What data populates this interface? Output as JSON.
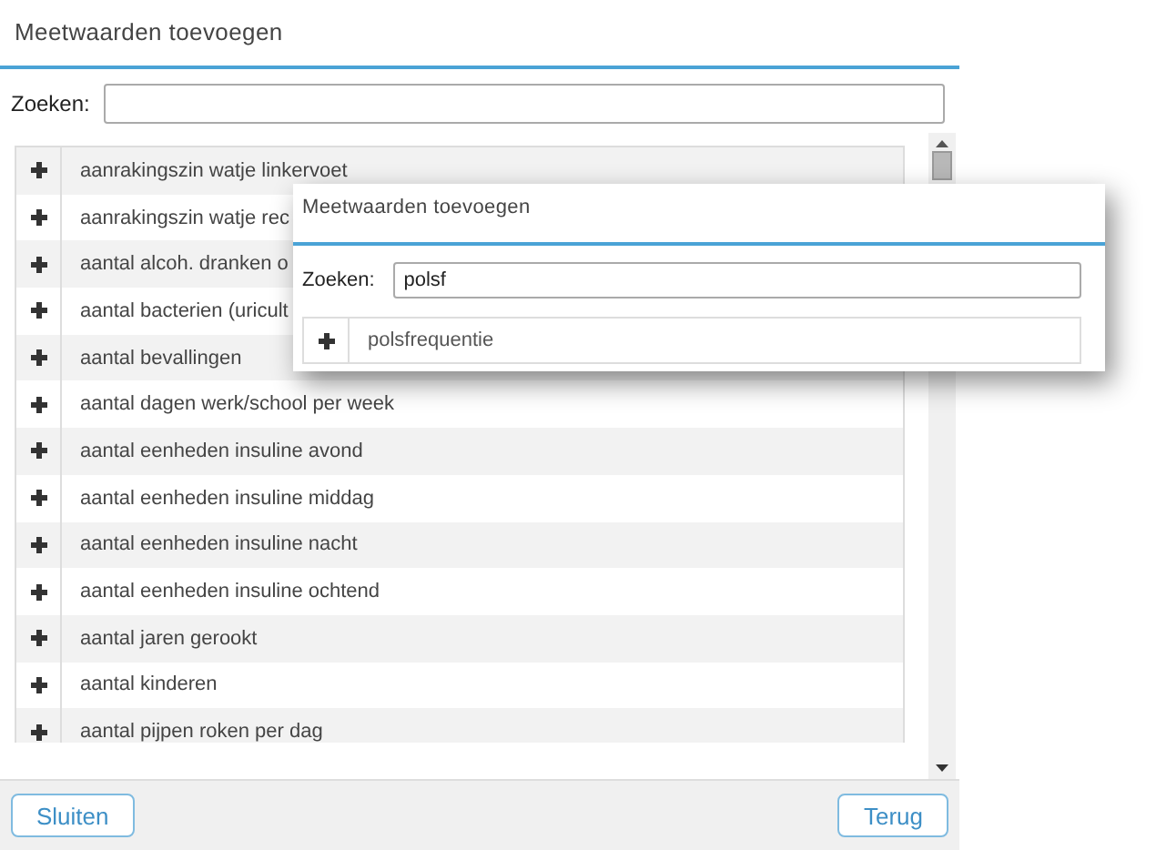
{
  "dialog": {
    "title": "Meetwaarden toevoegen",
    "search": {
      "label": "Zoeken:"
    },
    "items": [
      {
        "label": "aanrakingszin watje linkervoet"
      },
      {
        "label": "aanrakingszin watje rec"
      },
      {
        "label": "aantal alcoh. dranken o"
      },
      {
        "label": "aantal bacterien (uricult"
      },
      {
        "label": "aantal bevallingen"
      },
      {
        "label": "aantal dagen werk/school per week"
      },
      {
        "label": "aantal eenheden insuline avond"
      },
      {
        "label": "aantal eenheden insuline middag"
      },
      {
        "label": "aantal eenheden insuline nacht"
      },
      {
        "label": "aantal eenheden insuline ochtend"
      },
      {
        "label": "aantal jaren gerookt"
      },
      {
        "label": "aantal kinderen"
      },
      {
        "label": "aantal pijpen roken per dag"
      }
    ],
    "buttons": [
      {
        "label": "Sluiten"
      },
      {
        "label": "Terug"
      }
    ]
  },
  "overlay": {
    "title": "Meetwaarden toevoegen",
    "search": {
      "label": "Zoeken:",
      "value": "polsf"
    },
    "items": [
      {
        "label": "polsfrequentie"
      }
    ]
  }
}
